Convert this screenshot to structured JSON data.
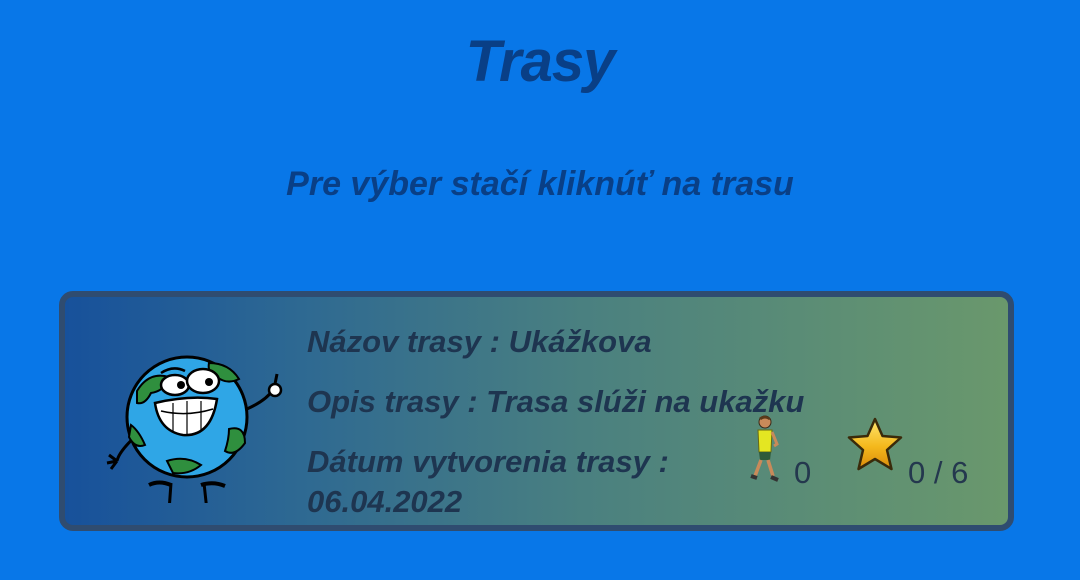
{
  "header": {
    "title": "Trasy",
    "subtitle": "Pre výber stačí kliknúť na trasu"
  },
  "route": {
    "name_line": "Názov trasy : Ukážkova",
    "description_line": "Opis trasy : Trasa slúži na ukažku",
    "date_label": "Dátum vytvorenia trasy :",
    "date_value": "06.04.2022",
    "walkers_count": "0",
    "stars_count": "0 / 6",
    "icons": [
      "globe-mascot-icon",
      "walking-person-icon",
      "star-icon"
    ]
  },
  "colors": {
    "background": "#0877E8",
    "heading": "#093F86",
    "card_border": "#2F4C70",
    "card_gradient_start": "#17519B",
    "card_gradient_end": "#6A986C",
    "card_text": "#1E3550"
  }
}
